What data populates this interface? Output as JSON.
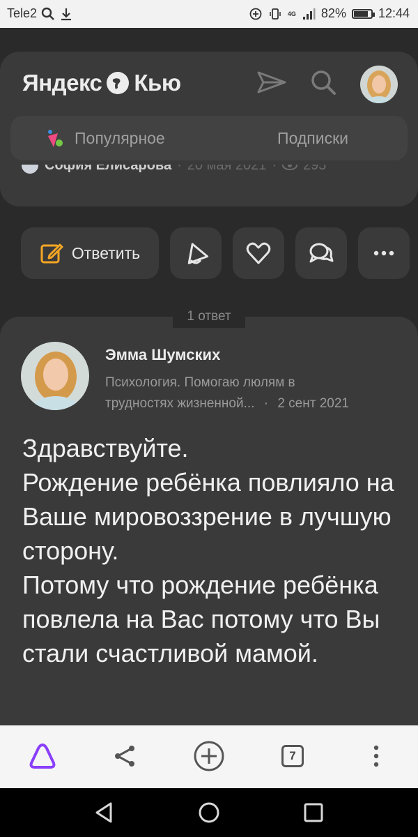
{
  "status_bar": {
    "carrier": "Tele2",
    "network": "4G",
    "battery": "82%",
    "battery_level": 0.82,
    "time": "12:44"
  },
  "header": {
    "logo_text_1": "Яндекс",
    "logo_text_2": "Кью",
    "icons": [
      "send-icon",
      "search-icon"
    ]
  },
  "tabs": [
    {
      "label": "Популярное",
      "icon": "popular-icon"
    },
    {
      "label": "Подписки"
    }
  ],
  "question_meta": {
    "author": "София Елисарова",
    "date": "20 мая 2021",
    "views": "295"
  },
  "actions": {
    "reply_label": "Ответить",
    "icons": [
      "share-icon",
      "like-icon",
      "comments-icon",
      "more-icon"
    ]
  },
  "answers_count_label": "1 ответ",
  "answer": {
    "author_name": "Эмма Шумских",
    "author_bio_line1": "Психология. Помогаю люлям в",
    "author_bio_line2": "трудностях жизненной...",
    "separator": "·",
    "date": "2 сент 2021",
    "text": "Здравствуйте.\nРождение ребёнка повлияло на Ваше мировоззрение в лучшую сторону.\nПотому что рождение ребёнка повлела на Вас потому что Вы стали счастливой мамой."
  },
  "browser_bar": {
    "tabs_count": "7"
  },
  "colors": {
    "accent_alice": "#8a3ffc",
    "reply_icon": "#f5a623",
    "background": "#2a2a2a",
    "card": "#3a3a3a"
  }
}
